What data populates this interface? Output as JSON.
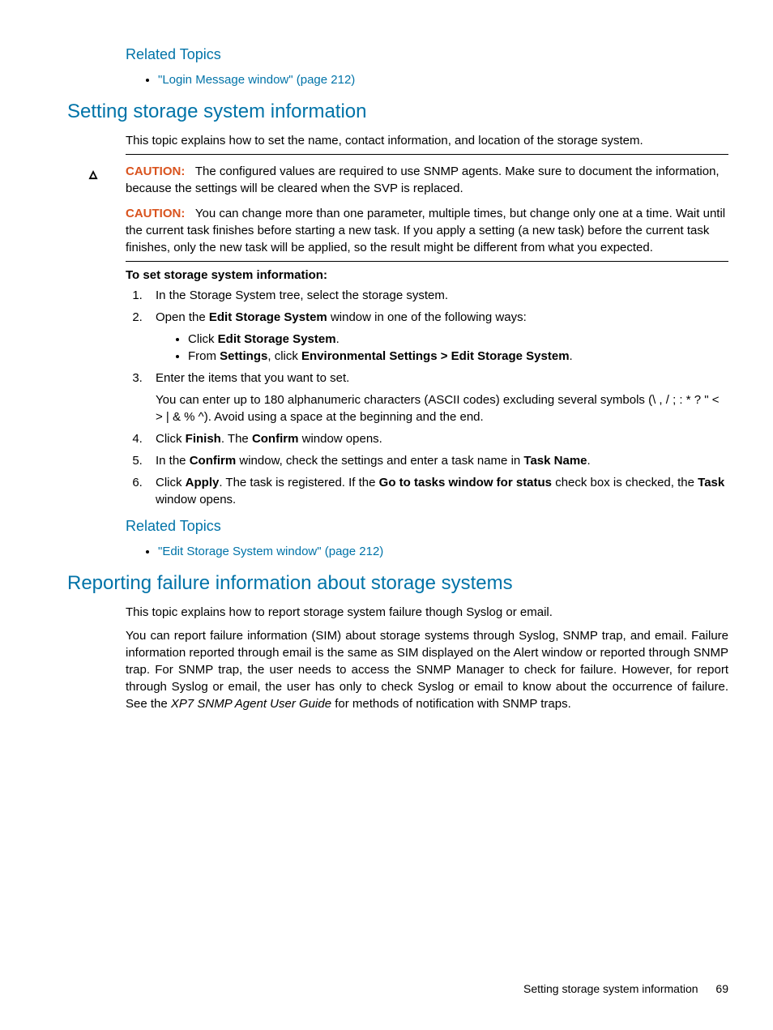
{
  "relatedTopics1": {
    "heading": "Related Topics",
    "link": "\"Login Message window\" (page 212)"
  },
  "section1": {
    "heading": "Setting storage system information",
    "intro": "This topic explains how to set the name, contact information, and location of the storage system."
  },
  "caution1": {
    "label": "CAUTION:",
    "text": "The configured values are required to use SNMP agents. Make sure to document the information, because the settings will be cleared when the SVP is replaced."
  },
  "caution2": {
    "label": "CAUTION:",
    "text": "You can change more than one parameter, multiple times, but change only one at a time. Wait until the current task finishes before starting a new task. If you apply a setting (a new task) before the current task finishes, only the new task will be applied, so the result might be different from what you expected."
  },
  "procedure": {
    "heading": "To set storage system information:",
    "step1": "In the Storage System tree, select the storage system.",
    "step2_a": "Open the ",
    "step2_b": "Edit Storage System",
    "step2_c": " window in one of the following ways:",
    "step2_sub1_a": "Click ",
    "step2_sub1_b": "Edit Storage System",
    "step2_sub1_c": ".",
    "step2_sub2_a": "From ",
    "step2_sub2_b": "Settings",
    "step2_sub2_c": ", click ",
    "step2_sub2_d": "Environmental Settings > Edit Storage System",
    "step2_sub2_e": ".",
    "step3_a": "Enter the items that you want to set.",
    "step3_extra": "You can enter up to 180 alphanumeric characters (ASCII codes) excluding several symbols (\\ , / ; : * ? \" < > | & % ^). Avoid using a space at the beginning and the end.",
    "step4_a": "Click ",
    "step4_b": "Finish",
    "step4_c": ". The ",
    "step4_d": "Confirm",
    "step4_e": " window opens.",
    "step5_a": "In the ",
    "step5_b": "Confirm",
    "step5_c": " window, check the settings and enter a task name in ",
    "step5_d": "Task Name",
    "step5_e": ".",
    "step6_a": "Click ",
    "step6_b": "Apply",
    "step6_c": ". The task is registered. If the ",
    "step6_d": "Go to tasks window for status",
    "step6_e": " check box is checked, the ",
    "step6_f": "Task",
    "step6_g": " window opens."
  },
  "relatedTopics2": {
    "heading": "Related Topics",
    "link": "\"Edit Storage System window\" (page 212)"
  },
  "section2": {
    "heading": "Reporting failure information about storage systems",
    "intro": "This topic explains how to report storage system failure though Syslog or email.",
    "body_a": "You can report failure information (SIM) about storage systems through Syslog, SNMP trap, and email. Failure information reported through email is the same as SIM displayed on the Alert window or reported through SNMP trap. For SNMP trap, the user needs to access the SNMP Manager to check for failure. However, for report through Syslog or email, the user has only to check Syslog or email to know about the occurrence of failure. See the ",
    "body_italic": "XP7 SNMP Agent User Guide",
    "body_b": " for methods of notification with SNMP traps."
  },
  "footer": {
    "text": "Setting storage system information",
    "page": "69"
  }
}
